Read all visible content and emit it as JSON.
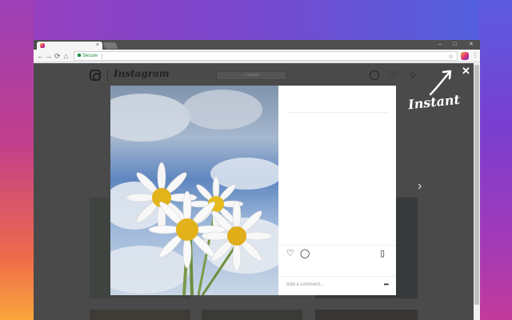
{
  "browser": {
    "tab_close": "×",
    "window_controls": [
      "–",
      "□",
      "✕"
    ],
    "nav": {
      "back": "←",
      "forward": "→",
      "reload": "⟳",
      "home": "⌂"
    },
    "secure_label": "Secure",
    "star": "☆",
    "menu": "⋮"
  },
  "instagram": {
    "wordmark": "Instagram",
    "search_placeholder": "⌕ Search",
    "next": "›"
  },
  "post": {
    "like_icon": "♡",
    "comment_icon": "◯",
    "save_icon": "▯",
    "comment_placeholder": "Add a comment...",
    "more": "•••"
  },
  "overlay": {
    "close": "✕",
    "caption": "Instant"
  },
  "colors": {
    "modal_bg": "#ffffff",
    "page_dim": "#4a4a4a",
    "secure_green": "#1e8e3e"
  }
}
